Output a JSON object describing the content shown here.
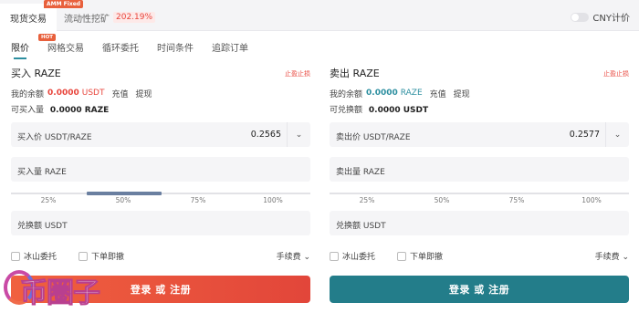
{
  "topbar": {
    "spot_tab": "现货交易",
    "amm_badge": "AMM Fixed",
    "amm_tab": "流动性挖矿",
    "amm_pct": "202.19%",
    "cny_label": "CNY计价"
  },
  "order_tabs": {
    "hot_badge": "HOT",
    "items": [
      "限价",
      "网格交易",
      "循环委托",
      "时间条件",
      "追踪订单"
    ]
  },
  "buy": {
    "title": "买入 RAZE",
    "stop_link": "止盈止损",
    "balance_label": "我的余额",
    "balance_amount": "0.0000",
    "balance_unit": "USDT",
    "deposit": "充值",
    "withdraw": "提现",
    "avail_label": "可买入量",
    "avail_amount": "0.0000 RAZE",
    "price_label": "买入价 USDT/RAZE",
    "price_value": "0.2565",
    "amount_label": "买入量 RAZE",
    "slider_marks": [
      "25%",
      "50%",
      "75%",
      "100%"
    ],
    "slider_level": 0.5,
    "total_label": "兑换额 USDT",
    "iceberg": "冰山委托",
    "ioc": "下单即撤",
    "fee": "手续费",
    "button": "登录 或 注册"
  },
  "sell": {
    "title": "卖出 RAZE",
    "stop_link": "止盈止损",
    "balance_label": "我的余额",
    "balance_amount": "0.0000",
    "balance_unit": "RAZE",
    "deposit": "充值",
    "withdraw": "提现",
    "avail_label": "可兑换额",
    "avail_amount": "0.0000 USDT",
    "price_label": "卖出价 USDT/RAZE",
    "price_value": "0.2577",
    "amount_label": "卖出量 RAZE",
    "slider_marks": [
      "25%",
      "50%",
      "75%",
      "100%"
    ],
    "total_label": "兑换额 USDT",
    "iceberg": "冰山委托",
    "ioc": "下单即撤",
    "fee": "手续费",
    "button": "登录 或 注册"
  },
  "watermark": {
    "text": "币圈子"
  },
  "colors": {
    "buy_accent": "#e8453c",
    "sell_accent": "#237d8a",
    "active_tab": "#2d8fa0"
  }
}
